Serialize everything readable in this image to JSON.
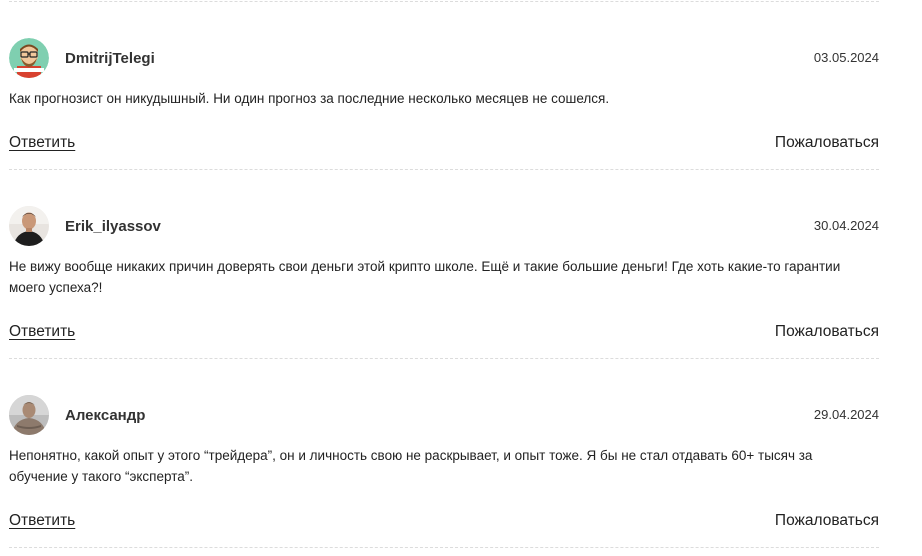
{
  "comments": [
    {
      "author": "DmitrijTelegi",
      "date": "03.05.2024",
      "text": "Как прогнозист он никудышный. Ни один прогноз за последние несколько месяцев не сошелся.",
      "reply_label": "Ответить",
      "report_label": "Пожаловаться",
      "avatar_icon": "cartoon-avatar-icon"
    },
    {
      "author": "Erik_ilyassov",
      "date": "30.04.2024",
      "text": "Не вижу вообще никаких причин доверять свои деньги этой крипто школе. Ещё и такие большие деньги! Где хоть какие-то гарантии моего успеха?!",
      "reply_label": "Ответить",
      "report_label": "Пожаловаться",
      "avatar_icon": "user-photo-avatar"
    },
    {
      "author": "Александр",
      "date": "29.04.2024",
      "text": "Непонятно, какой опыт у этого “трейдера”, он и личность свою не раскрывает, и опыт тоже. Я бы не стал отдавать 60+ тысяч за обучение у такого “эксперта”.",
      "reply_label": "Ответить",
      "report_label": "Пожаловаться",
      "avatar_icon": "user-photo-avatar"
    }
  ],
  "colors": {
    "text": "#222222",
    "divider": "#dcdcdc",
    "avatar1_bg": "#7fcfb0"
  }
}
